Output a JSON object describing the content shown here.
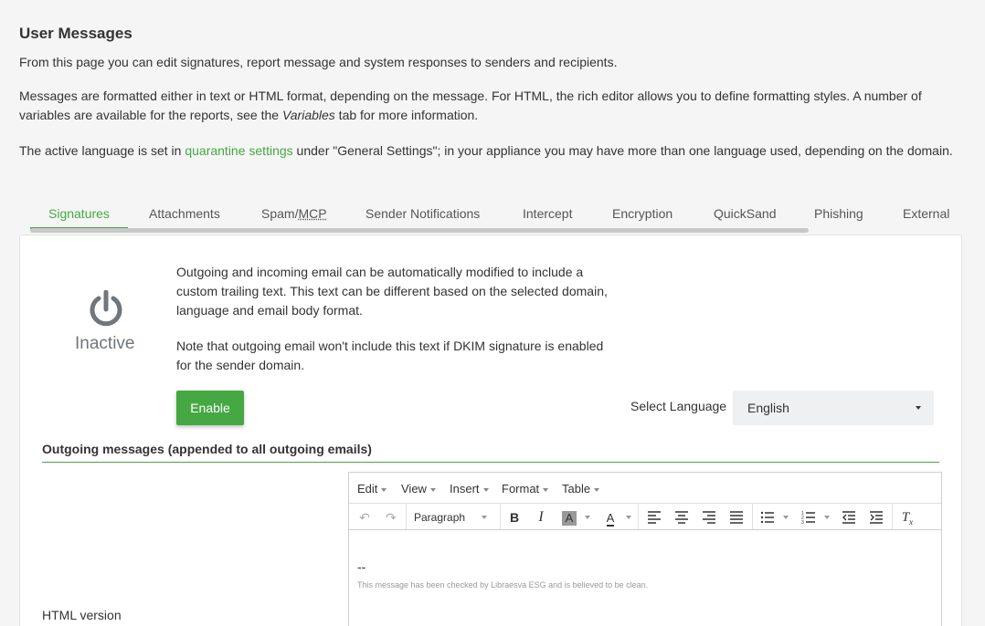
{
  "page": {
    "title": "User Messages",
    "intro": "From this page you can edit signatures, report message and system responses to senders and recipients.",
    "format_text_1": "Messages are formatted either in text or HTML format, depending on the message. For HTML, the rich editor allows you to define formatting styles. A number of variables are available for the reports, see the ",
    "format_variables": "Variables",
    "format_text_2": " tab for more information.",
    "lang_text_1": "The active language is set in ",
    "lang_link": "quarantine settings",
    "lang_text_2": " under \"General Settings\"; in your appliance you may have more than one language used, depending on the domain."
  },
  "tabs": [
    {
      "label": "Signatures",
      "active": true
    },
    {
      "label": "Attachments"
    },
    {
      "label": "Spam/",
      "abbr": "MCP"
    },
    {
      "label": "Sender Notifications"
    },
    {
      "label": "Intercept"
    },
    {
      "label": "Encryption"
    },
    {
      "label": "QuickSand"
    },
    {
      "label": "Phishing"
    },
    {
      "label": "External"
    }
  ],
  "signatures": {
    "status": "Inactive",
    "description_1": "Outgoing and incoming email can be automatically modified to include a custom trailing text. This text can be different based on the selected domain, language and email body format.",
    "description_2": "Note that outgoing email won't include this text if DKIM signature is enabled for the sender domain.",
    "enable_label": "Enable",
    "select_language_label": "Select Language",
    "language_value": "English",
    "section_title": "Outgoing messages (appended to all outgoing emails)",
    "html_version_label": "HTML version"
  },
  "editor": {
    "menus": [
      "Edit",
      "View",
      "Insert",
      "Format",
      "Table"
    ],
    "block_format": "Paragraph",
    "content_dash": "--",
    "content_text": "This message has been checked by Libraesva ESG and is believed to be clean."
  },
  "colors": {
    "accent": "#45a842",
    "status_icon": "#6f767c"
  }
}
